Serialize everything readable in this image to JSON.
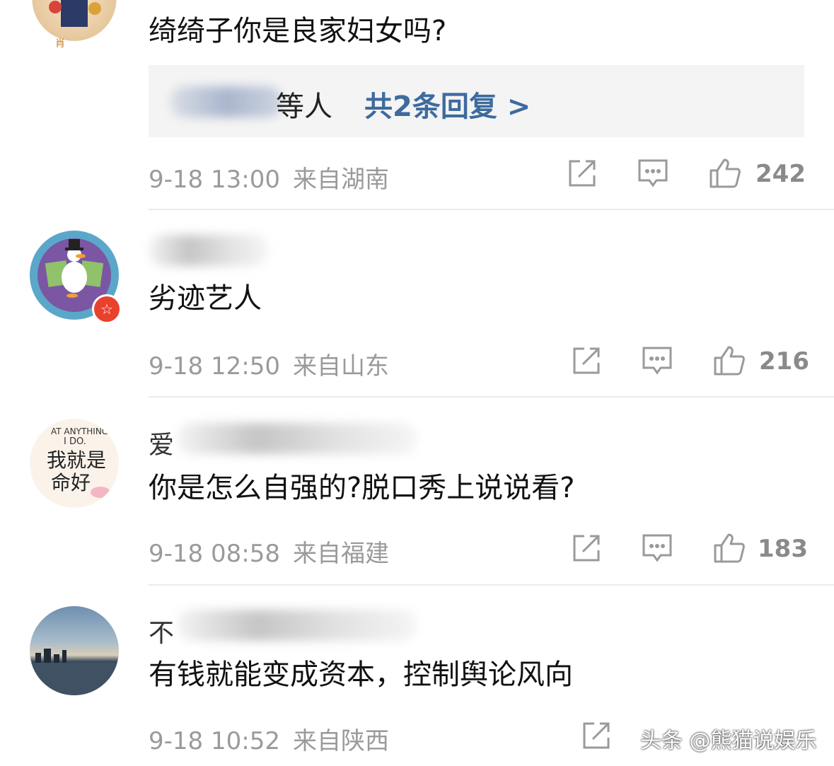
{
  "comments": [
    {
      "text": "绮绮子你是良家妇女吗?",
      "replies": {
        "names_suffix": "等人",
        "link": "共2条回复 >"
      },
      "time": "9-18 13:00",
      "location": "来自湖南",
      "likes": "242"
    },
    {
      "username_visible": "",
      "text": "劣迹艺人",
      "time": "9-18 12:50",
      "location": "来自山东",
      "likes": "216"
    },
    {
      "username_visible": "爱",
      "text": "你是怎么自强的?脱口秀上说说看?",
      "time": "9-18 08:58",
      "location": "来自福建",
      "likes": "183"
    },
    {
      "username_visible": "不",
      "text": "有钱就能变成资本，控制舆论风向",
      "time": "9-18 10:52",
      "location": "来自陕西",
      "likes": ""
    }
  ],
  "avatar2": {
    "badge_color": "#e8412c",
    "badge_glyph": "☆"
  },
  "avatar3": {
    "lines": [
      "AT ANYTHING",
      "I DO.",
      "我就是",
      "命好"
    ]
  },
  "watermark": "头条 @熊猫说娱乐",
  "icons": [
    "repost-icon",
    "comment-icon",
    "like-icon"
  ]
}
